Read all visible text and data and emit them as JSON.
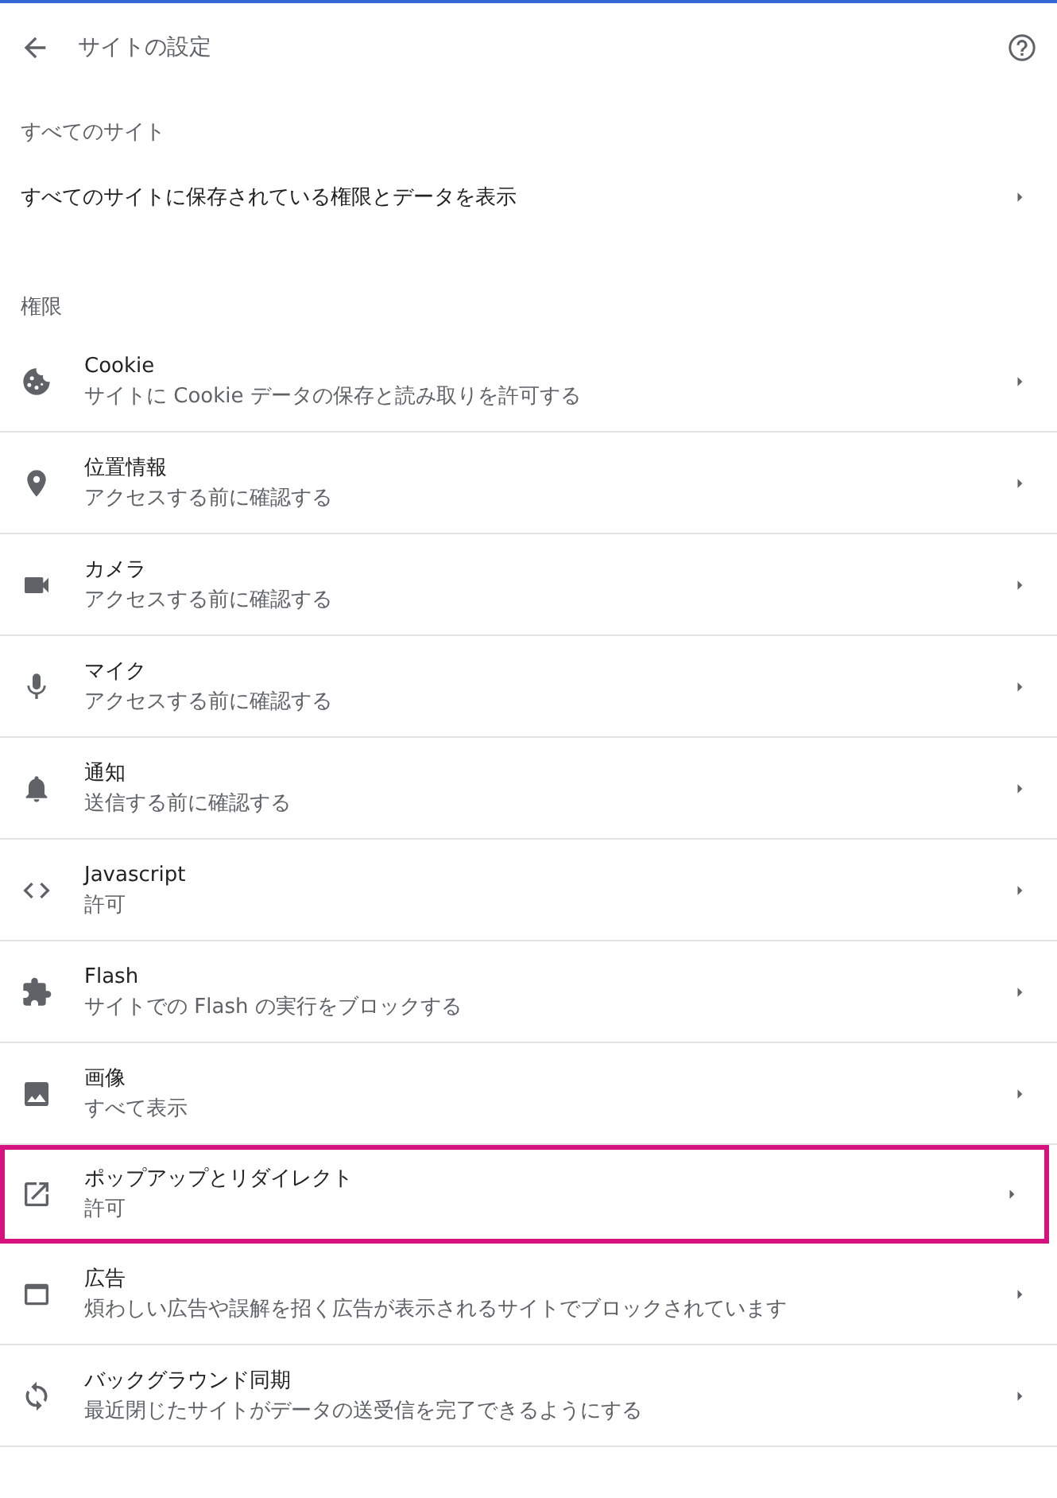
{
  "header": {
    "title": "サイトの設定"
  },
  "all_sites": {
    "heading": "すべてのサイト",
    "link": "すべてのサイトに保存されている権限とデータを表示"
  },
  "permissions": {
    "heading": "権限",
    "items": [
      {
        "kind": "cookie",
        "title": "Cookie",
        "subtitle": "サイトに Cookie データの保存と読み取りを許可する",
        "highlighted": false
      },
      {
        "kind": "location",
        "title": "位置情報",
        "subtitle": "アクセスする前に確認する",
        "highlighted": false
      },
      {
        "kind": "camera",
        "title": "カメラ",
        "subtitle": "アクセスする前に確認する",
        "highlighted": false
      },
      {
        "kind": "microphone",
        "title": "マイク",
        "subtitle": "アクセスする前に確認する",
        "highlighted": false
      },
      {
        "kind": "notification",
        "title": "通知",
        "subtitle": "送信する前に確認する",
        "highlighted": false
      },
      {
        "kind": "code",
        "title": "Javascript",
        "subtitle": "許可",
        "highlighted": false
      },
      {
        "kind": "plugin",
        "title": "Flash",
        "subtitle": "サイトでの Flash の実行をブロックする",
        "highlighted": false
      },
      {
        "kind": "image",
        "title": "画像",
        "subtitle": "すべて表示",
        "highlighted": false
      },
      {
        "kind": "popup",
        "title": "ポップアップとリダイレクト",
        "subtitle": "許可",
        "highlighted": true
      },
      {
        "kind": "ads",
        "title": "広告",
        "subtitle": "煩わしい広告や誤解を招く広告が表示されるサイトでブロックされています",
        "highlighted": false
      },
      {
        "kind": "sync",
        "title": "バックグラウンド同期",
        "subtitle": "最近閉じたサイトがデータの送受信を完了できるようにする",
        "highlighted": false
      }
    ]
  }
}
